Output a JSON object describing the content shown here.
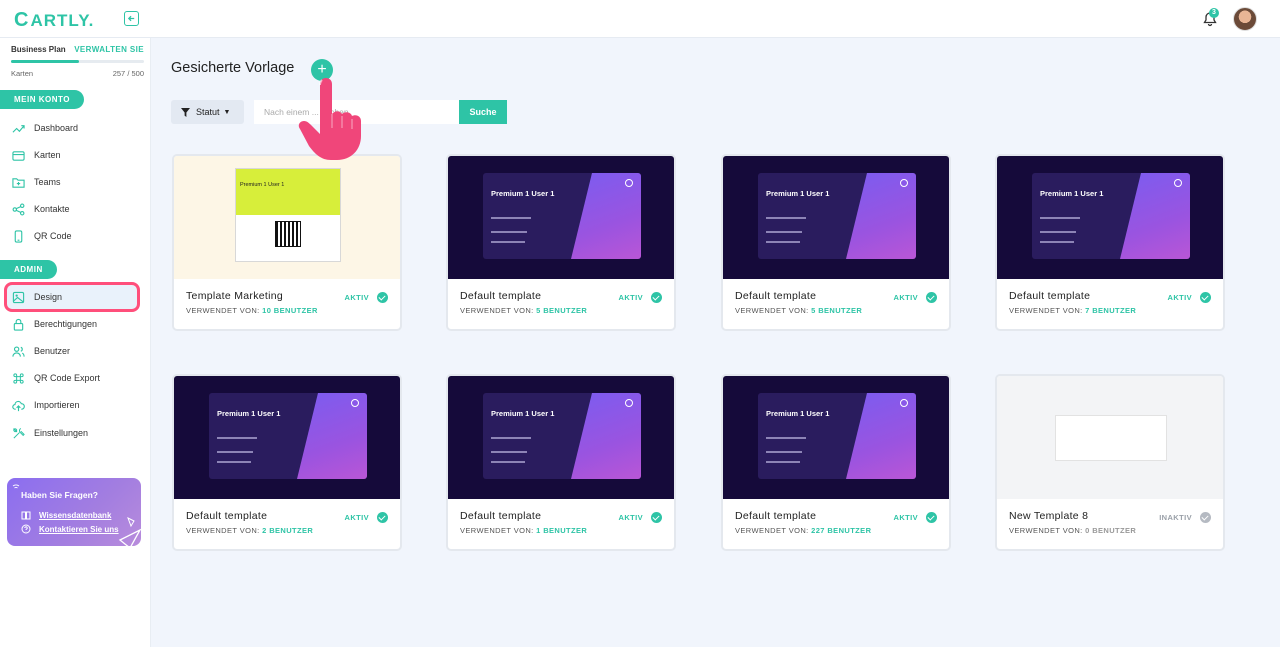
{
  "app": {
    "logo_c": "C",
    "logo_text": "ARTLY."
  },
  "header": {
    "notifications_count": "3"
  },
  "plan": {
    "name": "Business Plan",
    "manage_label": "VERWALTEN SIE",
    "usage_label": "Karten",
    "usage_value": "257 / 500",
    "usage_fraction": 0.514
  },
  "sidebar": {
    "section_my_account": "MEIN KONTO",
    "section_admin": "ADMIN",
    "items": [
      {
        "label": "Dashboard",
        "icon": "trend-icon"
      },
      {
        "label": "Karten",
        "icon": "card-icon"
      },
      {
        "label": "Teams",
        "icon": "folder-plus-icon"
      },
      {
        "label": "Kontakte",
        "icon": "share-icon"
      },
      {
        "label": "QR Code",
        "icon": "phone-icon"
      },
      {
        "label": "Design",
        "icon": "image-icon"
      },
      {
        "label": "Berechtigungen",
        "icon": "lock-icon"
      },
      {
        "label": "Benutzer",
        "icon": "users-icon"
      },
      {
        "label": "QR Code Export",
        "icon": "command-icon"
      },
      {
        "label": "Importieren",
        "icon": "cloud-upload-icon"
      },
      {
        "label": "Einstellungen",
        "icon": "tools-icon"
      }
    ],
    "help": {
      "title": "Haben Sie Fragen?",
      "kb_link": "Wissensdatenbank",
      "contact_link": "Kontaktieren Sie uns"
    }
  },
  "main": {
    "title": "Gesicherte Vorlage",
    "add_label": "+",
    "filter_label": "Statut",
    "search_placeholder": "Nach einem ... suchen",
    "search_button": "Suche",
    "used_prefix": "VERWENDET VON: ",
    "templates": [
      {
        "name": "Template Marketing",
        "used_by": "10 BENUTZER",
        "status": "AKTIV",
        "preview": "marketing"
      },
      {
        "name": "Default template",
        "used_by": "5 BENUTZER",
        "status": "AKTIV",
        "preview": "dark"
      },
      {
        "name": "Default template",
        "used_by": "5 BENUTZER",
        "status": "AKTIV",
        "preview": "dark"
      },
      {
        "name": "Default template",
        "used_by": "7 BENUTZER",
        "status": "AKTIV",
        "preview": "dark"
      },
      {
        "name": "Default template",
        "used_by": "2 BENUTZER",
        "status": "AKTIV",
        "preview": "dark"
      },
      {
        "name": "Default template",
        "used_by": "1 BENUTZER",
        "status": "AKTIV",
        "preview": "dark"
      },
      {
        "name": "Default template",
        "used_by": "227 BENUTZER",
        "status": "AKTIV",
        "preview": "dark"
      },
      {
        "name": "New Template 8",
        "used_by": "0 BENUTZER",
        "status": "INAKTIV",
        "preview": "blank"
      }
    ],
    "preview_text": {
      "card_title": "Premium 1 User 1",
      "marketing_title": "Premium 1 User 1"
    }
  },
  "colors": {
    "accent": "#2ec4a6",
    "highlight": "#ff4f7b",
    "dark_card": "#150a3a"
  }
}
